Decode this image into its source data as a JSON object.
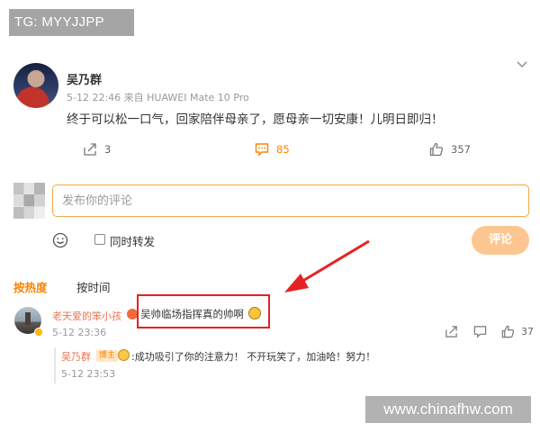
{
  "watermark": {
    "top": "TG: MYYJJPP",
    "bottom": "www.chinafhw.com"
  },
  "post": {
    "author": "吴乃群",
    "meta": "5-12 22:46  来自 HUAWEI Mate 10 Pro",
    "text": "终于可以松一口气，回家陪伴母亲了，愿母亲一切安康！儿明日即归！",
    "repost_count": "3",
    "comment_count": "85",
    "like_count": "357"
  },
  "composer": {
    "placeholder": "发布你的评论",
    "repost_label": "同时转发",
    "submit_label": "评论"
  },
  "sort": {
    "hot": "按热度",
    "time": "按时间"
  },
  "comments": [
    {
      "user": "老天爱的笨小孩",
      "text": "吴帅临场指挥真的帅啊",
      "time": "5-12 23:36",
      "like_count": "37",
      "reply": {
        "user": "吴乃群",
        "tag": "博主",
        "text": ":成功吸引了你的注意力！ 不开玩笑了，加油哈！努力！",
        "time": "5-12 23:53"
      }
    }
  ],
  "colors": {
    "accent": "#ff8200",
    "highlight": "#e52222",
    "submit": "#fdc690",
    "username": "#eb7350"
  }
}
